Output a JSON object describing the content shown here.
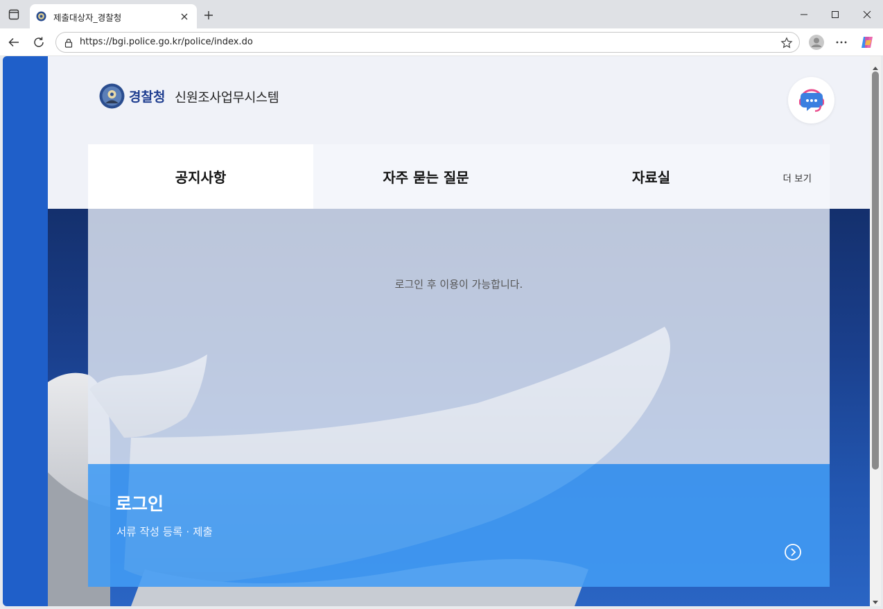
{
  "browser": {
    "tab_title": "제출대상자_경찰청",
    "url": "https://bgi.police.go.kr/police/index.do"
  },
  "header": {
    "brand": "경찰청",
    "system_title": "신원조사업무시스템"
  },
  "board": {
    "tabs": [
      {
        "label": "공지사항",
        "active": true
      },
      {
        "label": "자주 묻는 질문",
        "active": false
      },
      {
        "label": "자료실",
        "active": false
      }
    ],
    "more_label": "더 보기",
    "message": "로그인 후 이용이 가능합니다."
  },
  "login": {
    "title": "로그인",
    "subtitle": "서류 작성 등록 · 제출"
  },
  "colors": {
    "sidebar_strip": "#1f5fc9",
    "brand_text": "#1e3d8f",
    "login_panel": "#429cf5",
    "hero_bg": "#1a3f8c"
  },
  "icons": [
    "window-menu-icon",
    "favicon-icon",
    "close-icon",
    "plus-icon",
    "minimize-icon",
    "maximize-icon",
    "back-arrow-icon",
    "reload-icon",
    "lock-icon",
    "star-icon",
    "profile-icon",
    "more-icon",
    "copilot-icon",
    "chatbot-icon",
    "arrow-right-circle-icon"
  ]
}
